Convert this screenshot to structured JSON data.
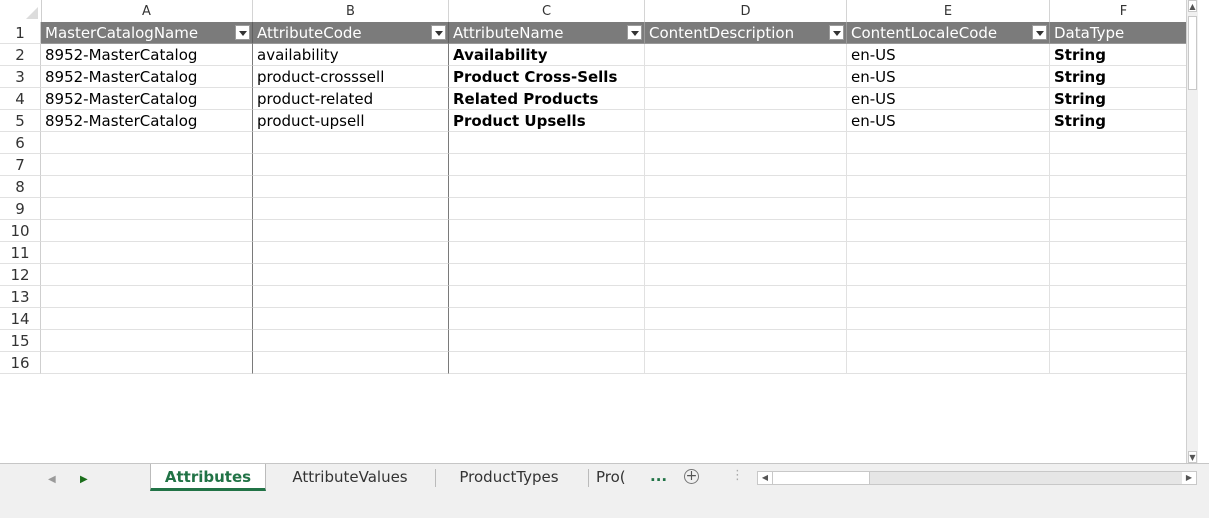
{
  "columns": [
    "A",
    "B",
    "C",
    "D",
    "E",
    "F"
  ],
  "header": [
    "MasterCatalogName",
    "AttributeCode",
    "AttributeName",
    "ContentDescription",
    "ContentLocaleCode",
    "DataType"
  ],
  "rows": [
    [
      "8952-MasterCatalog",
      "availability",
      "Availability",
      "",
      "en-US",
      "String"
    ],
    [
      "8952-MasterCatalog",
      "product-crosssell",
      "Product Cross-Sells",
      "",
      "en-US",
      "String"
    ],
    [
      "8952-MasterCatalog",
      "product-related",
      "Related Products",
      "",
      "en-US",
      "String"
    ],
    [
      "8952-MasterCatalog",
      "product-upsell",
      "Product Upsells",
      "",
      "en-US",
      "String"
    ]
  ],
  "row_numbers": [
    "1",
    "2",
    "3",
    "4",
    "5",
    "6",
    "7",
    "8",
    "9",
    "10",
    "11",
    "12",
    "13",
    "14",
    "15",
    "16"
  ],
  "tabs": {
    "items": [
      "Attributes",
      "AttributeValues",
      "ProductTypes",
      "Pro("
    ],
    "selected": "Attributes",
    "more": "...",
    "add": "+"
  },
  "colors": {
    "header_bg": "#7b7b7b",
    "accent": "#217346"
  }
}
